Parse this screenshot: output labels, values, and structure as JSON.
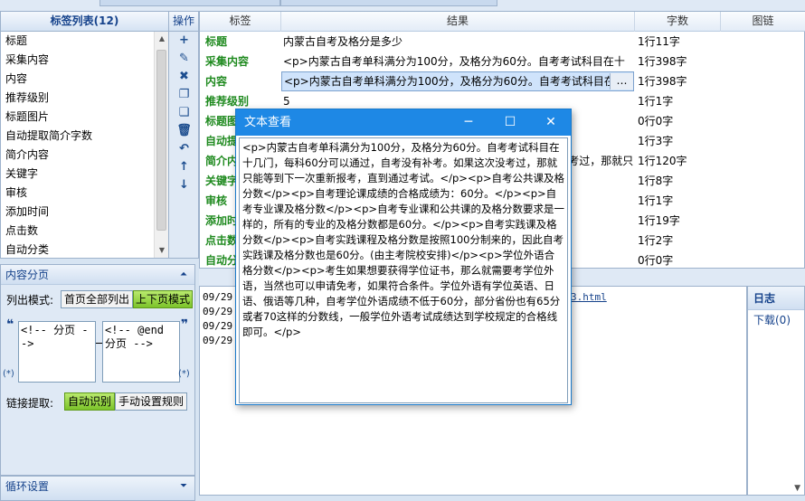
{
  "left_panel": {
    "title": "标签列表(12)",
    "tags": [
      "标题",
      "采集内容",
      "内容",
      "推荐级别",
      "标题图片",
      "自动提取简介字数",
      "简介内容",
      "关键字",
      "审核",
      "添加时间",
      "点击数",
      "自动分类"
    ]
  },
  "toolbar": {
    "title": "操作",
    "icons": [
      "plus-icon",
      "pencil-icon",
      "delete-icon",
      "copy-icon",
      "paste-icon",
      "trash-icon",
      "undo-icon",
      "arrow-up-icon",
      "arrow-down-icon"
    ],
    "glyphs": [
      "+",
      "✎",
      "✖",
      "❐",
      "❏",
      "🗑",
      "↶",
      "↑",
      "↓"
    ]
  },
  "table": {
    "headers": {
      "tag": "标签",
      "result": "结果",
      "count": "字数",
      "chain": "图链"
    },
    "rows": [
      {
        "tag": "标题",
        "result": "内蒙古自考及格分是多少",
        "count": "1行11字"
      },
      {
        "tag": "采集内容",
        "result": "<p>内蒙古自考单科满分为100分，及格分为60分。自考考试科目在十",
        "count": "1行398字"
      },
      {
        "tag": "内容",
        "result": "<p>内蒙古自考单科满分为100分，及格分为60分。自考考试科目在十",
        "count": "1行398字",
        "selected": true
      },
      {
        "tag": "推荐级别",
        "result": "5",
        "count": "1行1字"
      },
      {
        "tag": "标题图片",
        "result": "",
        "count": "0行0字"
      },
      {
        "tag": "自动提取简介字数",
        "result": "",
        "count": "1行3字"
      },
      {
        "tag": "简介内容",
        "result": "在十几门，每科60分可以通过，自考没有补考。如果这次没考过，那就只能等到下一次重新报考，直到通过考试。",
        "count": "1行120字"
      },
      {
        "tag": "关键字",
        "result": "",
        "count": "1行8字"
      },
      {
        "tag": "审核",
        "result": "",
        "count": "1行1字"
      },
      {
        "tag": "添加时间",
        "result": "",
        "count": "1行19字"
      },
      {
        "tag": "点击数",
        "result": "",
        "count": "1行2字"
      },
      {
        "tag": "自动分类",
        "result": "",
        "count": "0行0字"
      }
    ],
    "ellipsis": "…"
  },
  "paging": {
    "title": "内容分页",
    "list_mode_label": "列出模式:",
    "mode_all": "首页全部列出",
    "mode_prevnext": "上下页模式",
    "start_marker": "<!-- 分页 -->",
    "end_marker": "<!-- @end 分页 -->",
    "link_label": "链接提取:",
    "link_auto": "自动识别",
    "link_manual": "手动设置规则"
  },
  "loop": {
    "title": "循环设置"
  },
  "log": {
    "lines": [
      "09/29",
      "09/29",
      "09/29",
      "09/29"
    ],
    "link_text": "3.html",
    "side_title": "日志",
    "side_item": "下载(0)"
  },
  "dialog": {
    "title": "文本查看",
    "body": "<p>内蒙古自考单科满分为100分，及格分为60分。自考考试科目在十几门，每科60分可以通过，自考没有补考。如果这次没考过，那就只能等到下一次重新报考，直到通过考试。</p><p>自考公共课及格分数</p><p>自考理论课成绩的合格成绩为：60分。</p><p>自考专业课及格分数</p><p>自考专业课和公共课的及格分数要求是一样的，所有的专业的及格分数都是60分。</p><p>自考实践课及格分数</p><p>自考实践课程及格分数是按照100分制来的，因此自考实践课及格分数也是60分。(由主考院校安排)</p><p>学位外语合格分数</p><p>考生如果想要获得学位证书，那么就需要考学位外语，当然也可以申请免考，如果符合条件。学位外语有学位英语、日语、俄语等几种，自考学位外语成绩不低于60分，部分省份也有65分或者70这样的分数线，一般学位外语考试成绩达到学校规定的合格线即可。</p>"
  }
}
